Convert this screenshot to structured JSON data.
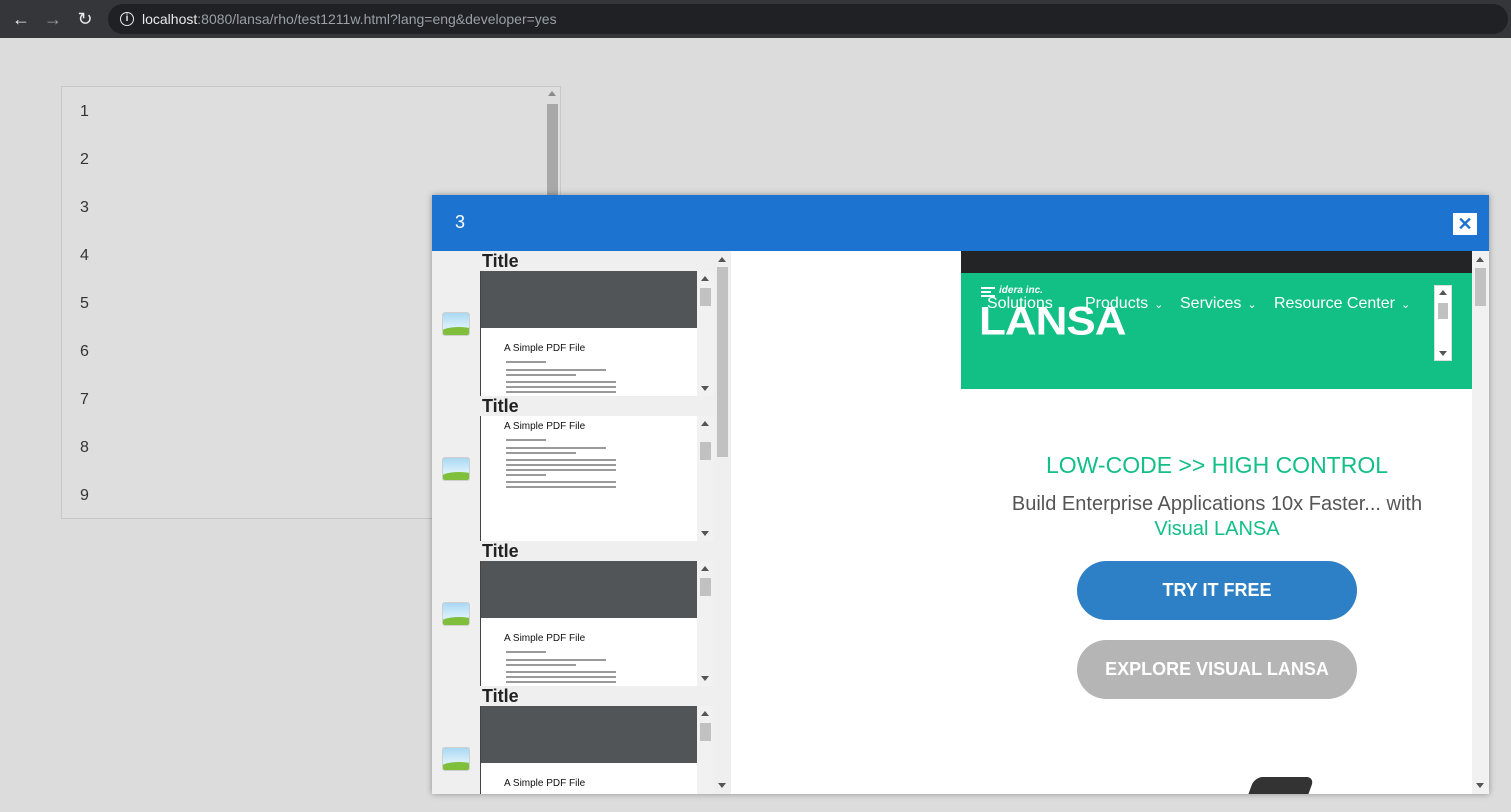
{
  "browser": {
    "url_host": "localhost",
    "url_rest": ":8080/lansa/rho/test1211w.html?lang=eng&developer=yes"
  },
  "list": {
    "items": [
      "1",
      "2",
      "3",
      "4",
      "5",
      "6",
      "7",
      "8",
      "9"
    ]
  },
  "dialog": {
    "title": "3",
    "close_icon": "close-icon",
    "items": [
      {
        "title": "Title",
        "pdf_title": "A Simple PDF File"
      },
      {
        "title": "Title",
        "pdf_title": "A Simple PDF File"
      },
      {
        "title": "Title",
        "pdf_title": "A Simple PDF File"
      },
      {
        "title": "Title",
        "pdf_title": "A Simple PDF File"
      }
    ]
  },
  "website": {
    "brand_small": "idera inc.",
    "brand_logo": "LANSA",
    "nav": [
      "Solutions",
      "Products",
      "Services",
      "Resource Center"
    ],
    "headline": "LOW-CODE >> HIGH CONTROL",
    "sub_text": "Build Enterprise Applications 10x Faster... with",
    "sub_accent": "Visual LANSA",
    "btn_try": "TRY IT FREE",
    "btn_explore": "EXPLORE VISUAL LANSA"
  },
  "colors": {
    "dialog_header": "#1c74d0",
    "site_green": "#12bf85",
    "try_button": "#2d7fc6"
  }
}
